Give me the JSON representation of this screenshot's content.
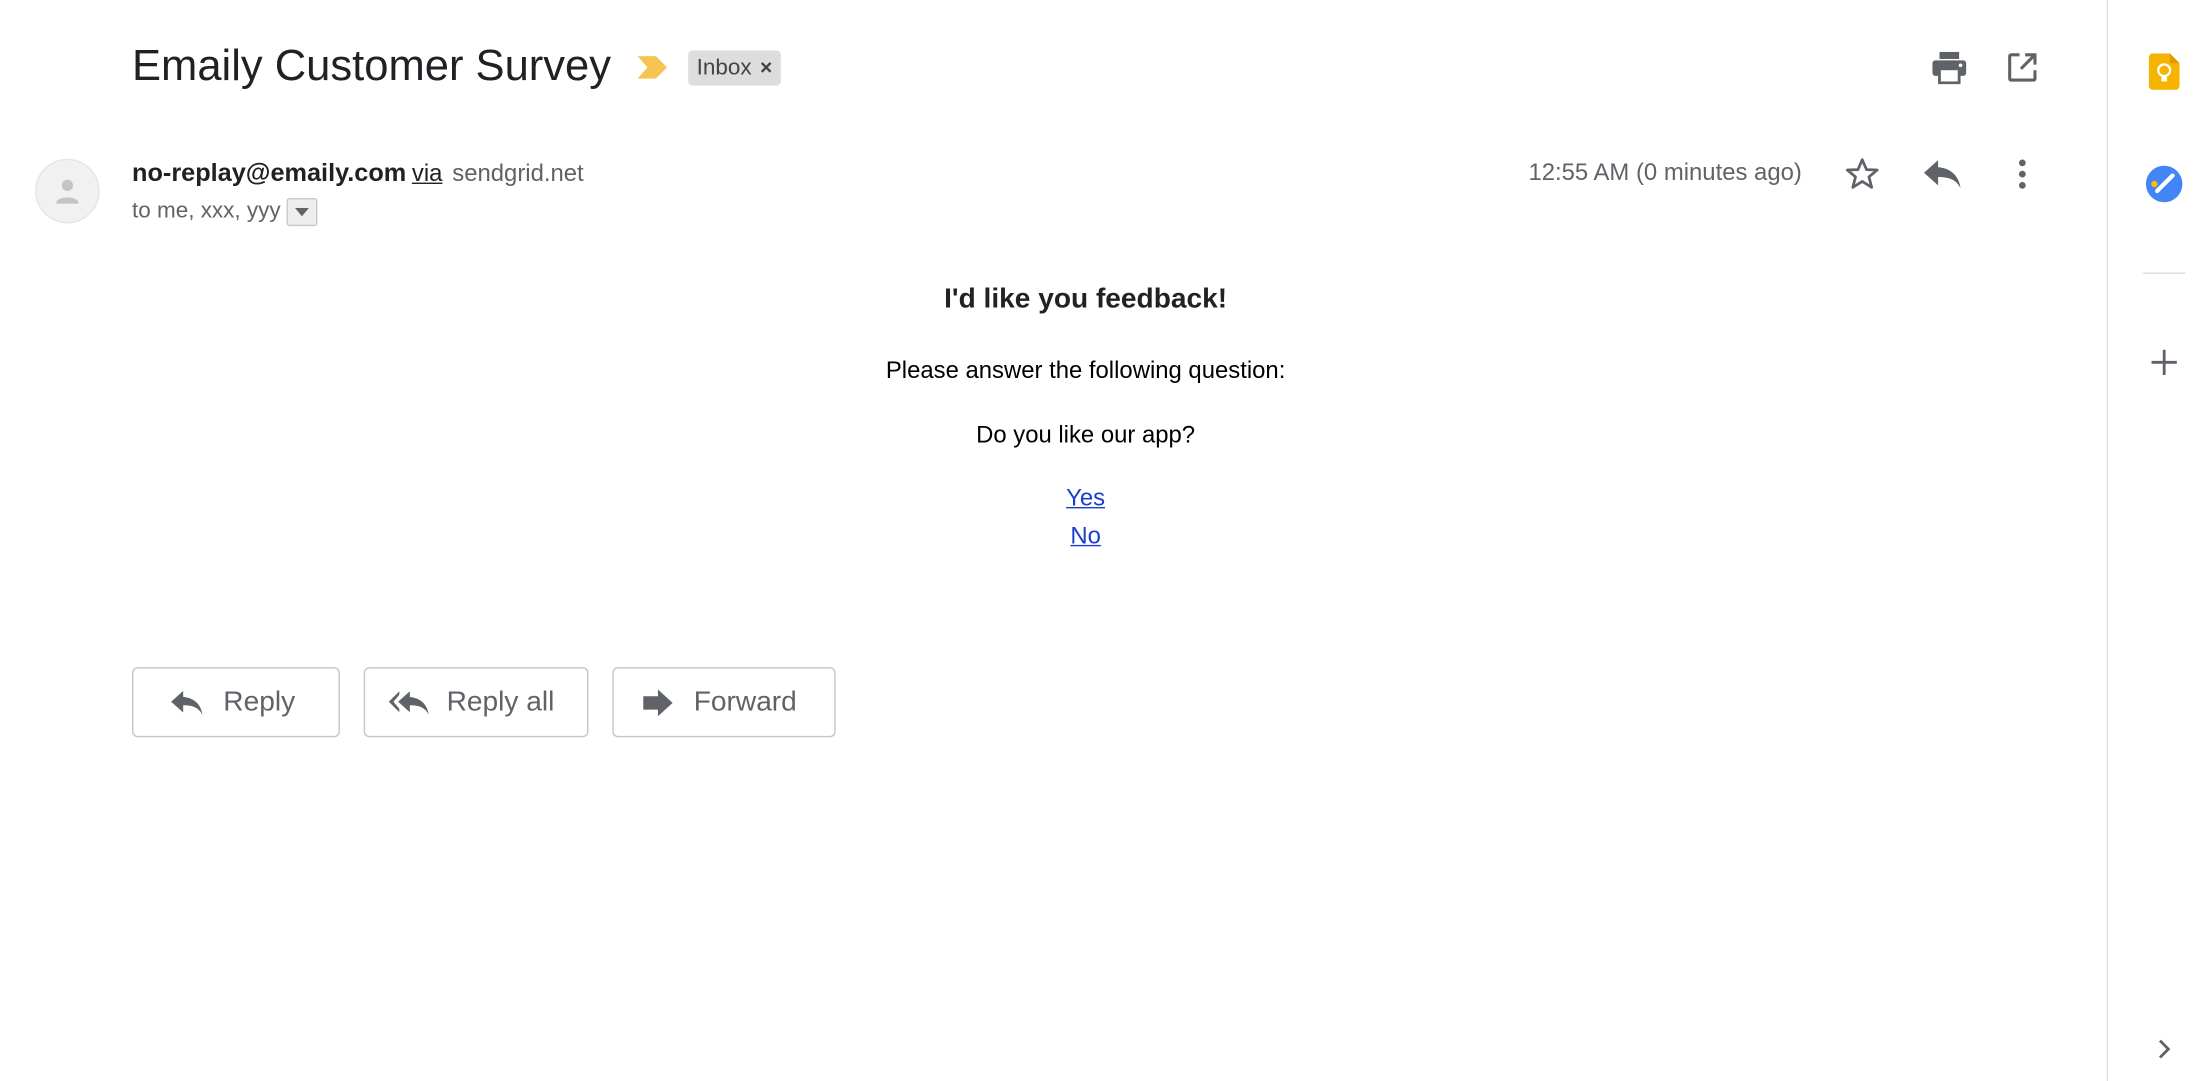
{
  "email": {
    "subject": "Emaily Customer Survey",
    "label": "Inbox",
    "label_remove": "×",
    "sender": "no-replay@emaily.com",
    "via": "via",
    "via_domain": "sendgrid.net",
    "recipients": "to me, xxx, yyy",
    "timestamp": "12:55 AM (0 minutes ago)"
  },
  "body": {
    "heading": "I'd like you feedback!",
    "instruction": "Please answer the following question:",
    "question": "Do you like our app?",
    "options": [
      "Yes",
      "No"
    ]
  },
  "actions": {
    "reply": "Reply",
    "reply_all": "Reply all",
    "forward": "Forward"
  },
  "icons": {
    "print": "print-icon",
    "open_new_window": "open-in-new-window-icon",
    "star": "star-icon",
    "reply": "reply-icon",
    "more": "more-vert-icon",
    "keep": "keep-lightbulb-icon",
    "tasks": "tasks-icon",
    "add": "plus-icon",
    "expand": "chevron-right-icon"
  },
  "colors": {
    "importance_marker": "#f6c453",
    "keep_yellow": "#f5b400",
    "tasks_blue": "#4285f4",
    "link_blue": "#1a3fcc"
  }
}
